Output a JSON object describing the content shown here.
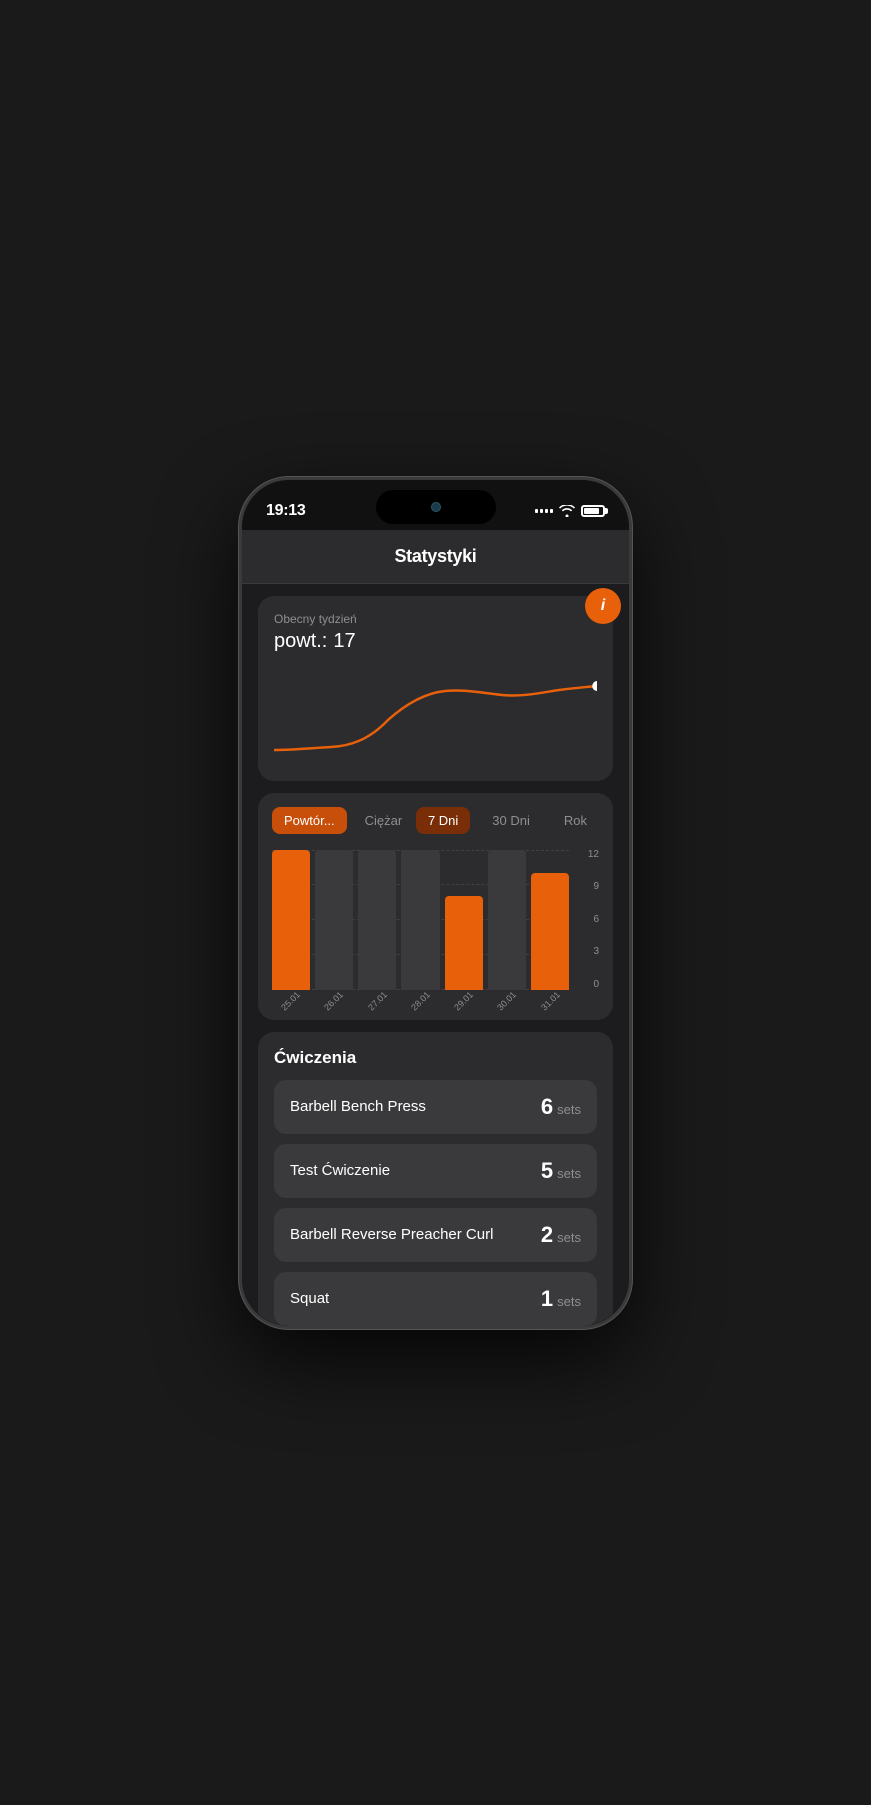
{
  "status_bar": {
    "time": "19:13",
    "battery_level": 85
  },
  "page": {
    "title": "Statystyki"
  },
  "info_button": {
    "label": "i"
  },
  "line_chart": {
    "period_label": "Obecny tydzień",
    "metric_prefix": "powt.:",
    "metric_value": "17"
  },
  "filters": {
    "left": [
      {
        "label": "Powtór...",
        "active": true
      },
      {
        "label": "Ciężar",
        "active": false
      }
    ],
    "right": [
      {
        "label": "7 Dni",
        "active": true
      },
      {
        "label": "30 Dni",
        "active": false
      },
      {
        "label": "Rok",
        "active": false
      }
    ]
  },
  "bar_chart": {
    "y_labels": [
      "0",
      "3",
      "6",
      "9",
      "12"
    ],
    "bars": [
      {
        "date": "25.01",
        "value": 12,
        "active": true
      },
      {
        "date": "26.01",
        "value": 0,
        "active": false
      },
      {
        "date": "27.01",
        "value": 0,
        "active": false
      },
      {
        "date": "28.01",
        "value": 0,
        "active": false
      },
      {
        "date": "29.01",
        "value": 8,
        "active": true
      },
      {
        "date": "30.01",
        "value": 0,
        "active": false
      },
      {
        "date": "31.01",
        "value": 10,
        "active": true
      }
    ],
    "max_value": 12
  },
  "exercises_section": {
    "title": "Ćwiczenia",
    "items": [
      {
        "name": "Barbell Bench Press",
        "sets": 6,
        "sets_label": "sets"
      },
      {
        "name": "Test Ćwiczenie",
        "sets": 5,
        "sets_label": "sets"
      },
      {
        "name": "Barbell Reverse Preacher Curl",
        "sets": 2,
        "sets_label": "sets"
      },
      {
        "name": "Squat",
        "sets": 1,
        "sets_label": "sets"
      }
    ]
  }
}
